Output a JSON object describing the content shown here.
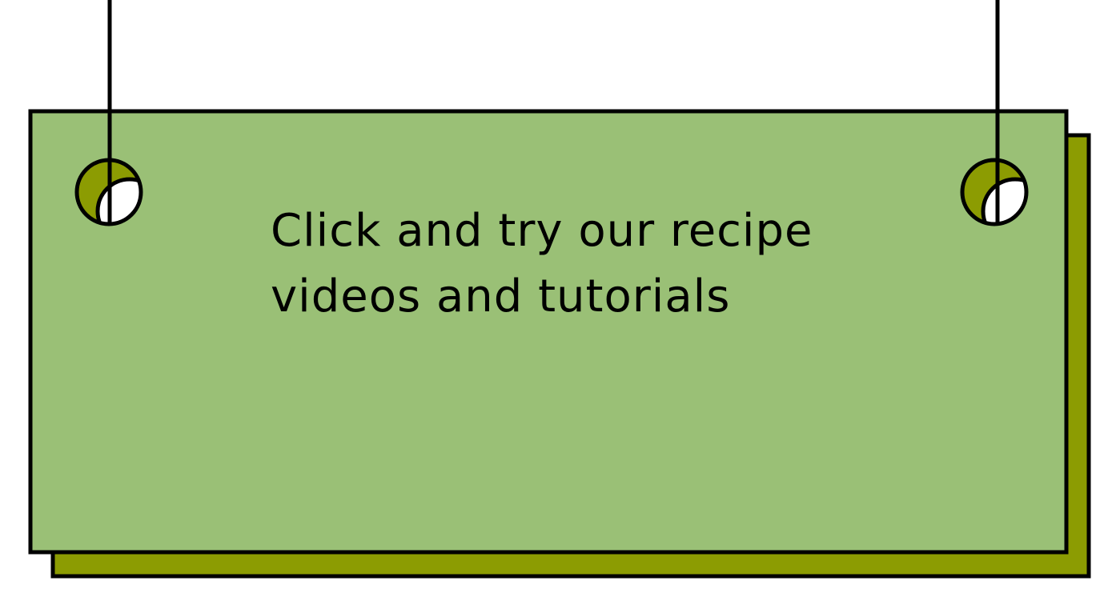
{
  "banner": {
    "lines": [
      "Click and try our recipe",
      "videos and tutorials"
    ]
  },
  "colors": {
    "card": "#9ac076",
    "shadow": "#8c9c02",
    "outline": "#000000"
  }
}
